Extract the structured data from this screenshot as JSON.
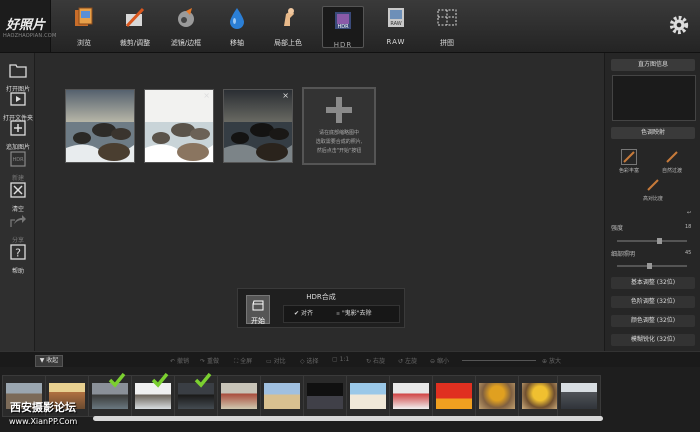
{
  "logo": {
    "title": "好照片",
    "subtitle": "HAOZHAOPIAN.COM"
  },
  "top_tools": [
    {
      "label": "浏览",
      "icon": "browse-icon"
    },
    {
      "label": "裁剪/调整",
      "icon": "crop-adjust-icon"
    },
    {
      "label": "滤镜/边框",
      "icon": "filter-frame-icon"
    },
    {
      "label": "移轴",
      "icon": "tilt-shift-icon"
    },
    {
      "label": "局部上色",
      "icon": "local-color-icon"
    },
    {
      "label": "HDR",
      "icon": "hdr-icon"
    },
    {
      "label": "RAW",
      "icon": "raw-icon"
    },
    {
      "label": "拼图",
      "icon": "collage-icon"
    }
  ],
  "left_tools": [
    {
      "label": "打开图片",
      "icon": "open-image-icon"
    },
    {
      "label": "打开文件夹",
      "icon": "open-folder-icon"
    },
    {
      "label": "追加图片",
      "icon": "add-image-icon"
    },
    {
      "label": "新建",
      "icon": "new-hdr-icon"
    },
    {
      "label": "清空",
      "icon": "clear-icon"
    },
    {
      "label": "分享",
      "icon": "share-icon"
    },
    {
      "label": "帮助",
      "icon": "help-icon"
    }
  ],
  "add_box_text": [
    "请在底部缩略图中",
    "选取需要合成的照片,",
    "然后点击\"开始\"按钮"
  ],
  "hdr_panel": {
    "title": "HDR合成",
    "start_label": "开始",
    "align_label": "对齐",
    "ghost_label": "\"鬼影\"去除"
  },
  "right_panel": {
    "histogram_label": "直方图信息",
    "tone_label": "色调映射",
    "modes": [
      "色彩丰富",
      "自然过渡",
      "高对比度"
    ],
    "intensity_label": "强度",
    "intensity_value": "18",
    "detail_label": "细部照明",
    "detail_value": "45",
    "sections": [
      "基本调整 (32位)",
      "色阶调整 (32位)",
      "颜色调整 (32位)",
      "模糊锐化 (32位)"
    ]
  },
  "bottom_toolbar": {
    "collapse_label": "收起",
    "tools": [
      "撤销",
      "重做",
      "全屏",
      "对比",
      "选择",
      "1:1",
      "右旋",
      "左旋",
      "缩小",
      "放大"
    ]
  },
  "filmstrip_checked": [
    2,
    3,
    4
  ],
  "watermark": {
    "line1": "西安摄影论坛",
    "line2": "www.XianPP.Com"
  }
}
